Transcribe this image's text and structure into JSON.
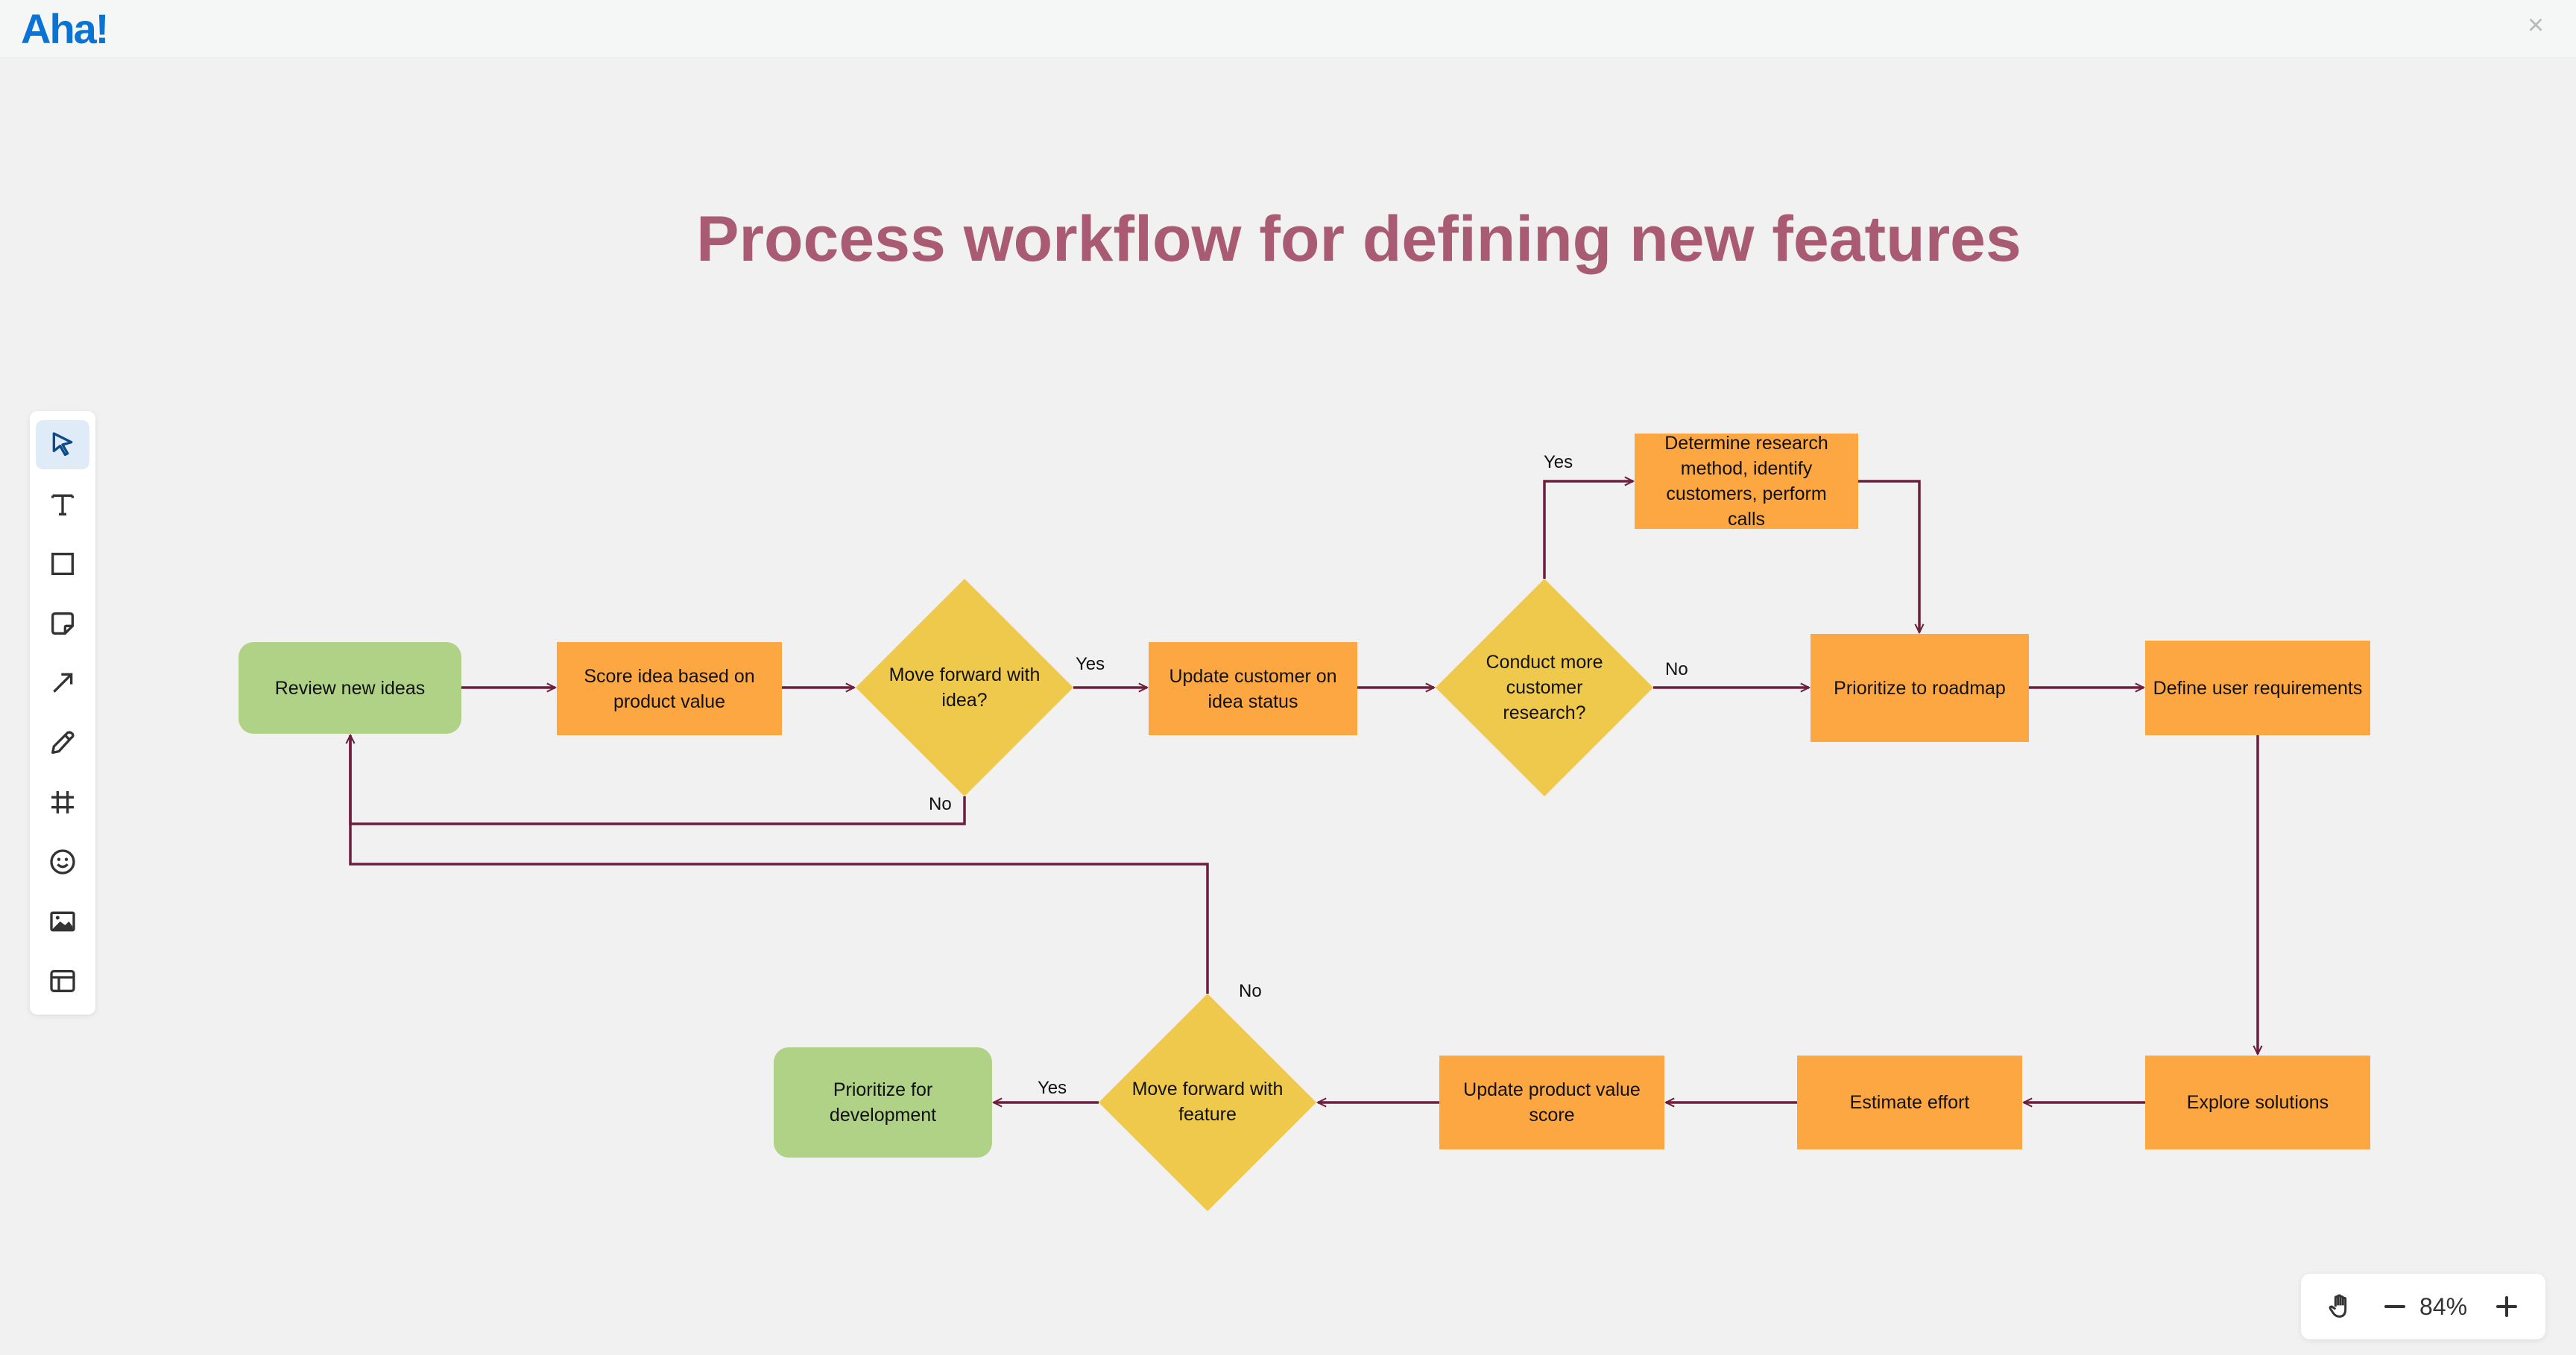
{
  "app": {
    "logo": "Aha!",
    "close_label": "×"
  },
  "board": {
    "title": "Process workflow for defining new features"
  },
  "toolbar": {
    "tools": [
      {
        "name": "select",
        "icon": "pointer-icon",
        "active": true
      },
      {
        "name": "text",
        "icon": "text-icon"
      },
      {
        "name": "shape",
        "icon": "rectangle-icon"
      },
      {
        "name": "sticky-note",
        "icon": "sticky-note-icon"
      },
      {
        "name": "arrow",
        "icon": "arrow-icon"
      },
      {
        "name": "pen",
        "icon": "pencil-icon"
      },
      {
        "name": "frame",
        "icon": "frame-icon"
      },
      {
        "name": "emoji",
        "icon": "emoji-icon"
      },
      {
        "name": "image",
        "icon": "image-icon"
      },
      {
        "name": "template",
        "icon": "template-icon"
      }
    ]
  },
  "zoom": {
    "value": "84%",
    "hand_icon": "hand-icon",
    "minus_icon": "minus-icon",
    "plus_icon": "plus-icon"
  },
  "colors": {
    "process": "#fca742",
    "terminal": "#b0d286",
    "decision": "#efc94c",
    "connector": "#6e1f3d",
    "title": "#a95b73",
    "logo": "#0b73d4"
  },
  "nodes": {
    "review": "Review new ideas",
    "score": "Score idea based on product value",
    "decision_idea": "Move forward with idea?",
    "update_customer": "Update customer on idea status",
    "decision_research": "Conduct more customer research?",
    "determine": "Determine research method, identify customers, perform calls",
    "roadmap": "Prioritize to roadmap",
    "define": "Define user requirements",
    "explore": "Explore solutions",
    "estimate": "Estimate effort",
    "update_score": "Update product value score",
    "decision_feature": "Move forward with feature",
    "prioritize_dev": "Prioritize for development"
  },
  "edge_labels": {
    "idea_yes": "Yes",
    "idea_no": "No",
    "research_yes": "Yes",
    "research_no": "No",
    "feature_yes": "Yes",
    "feature_no": "No"
  }
}
